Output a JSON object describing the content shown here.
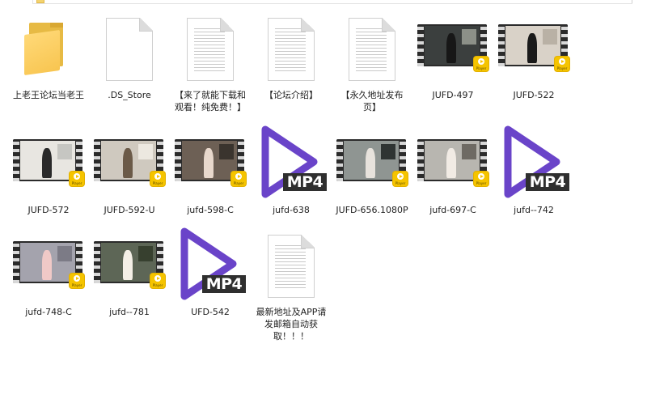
{
  "colors": {
    "folder": "#f8c550",
    "mp4_play": "#6a44c9",
    "player_badge": "#f5c400",
    "mp4_tag": "#2f2f2f"
  },
  "mp4_badge_text": "MP4",
  "player_badge_text": "Player",
  "files": [
    {
      "type": "folder",
      "icon": "folder-icon",
      "name": "上老王论坛当老王"
    },
    {
      "type": "document",
      "icon": "blank-document-icon",
      "name": ".DS_Store"
    },
    {
      "type": "document",
      "icon": "text-document-icon",
      "name": "【来了就能下载和观看！纯免费！】"
    },
    {
      "type": "document",
      "icon": "text-document-icon",
      "name": "【论坛介绍】"
    },
    {
      "type": "document",
      "icon": "text-document-icon",
      "name": "【永久地址发布页】"
    },
    {
      "type": "video",
      "icon": "video-thumbnail-icon",
      "name": "JUFD-497"
    },
    {
      "type": "video",
      "icon": "video-thumbnail-icon",
      "name": "JUFD-522"
    },
    {
      "type": "video",
      "icon": "video-thumbnail-icon",
      "name": "JUFD-572"
    },
    {
      "type": "video",
      "icon": "video-thumbnail-icon",
      "name": "JUFD-592-U"
    },
    {
      "type": "video",
      "icon": "video-thumbnail-icon",
      "name": "jufd-598-C"
    },
    {
      "type": "mp4",
      "icon": "mp4-play-icon",
      "name": "jufd-638"
    },
    {
      "type": "video",
      "icon": "video-thumbnail-icon",
      "name": "JUFD-656.1080P"
    },
    {
      "type": "video",
      "icon": "video-thumbnail-icon",
      "name": "jufd-697-C"
    },
    {
      "type": "mp4",
      "icon": "mp4-play-icon",
      "name": "jufd--742"
    },
    {
      "type": "video",
      "icon": "video-thumbnail-icon",
      "name": "jufd-748-C"
    },
    {
      "type": "video",
      "icon": "video-thumbnail-icon",
      "name": "jufd--781"
    },
    {
      "type": "mp4",
      "icon": "mp4-play-icon",
      "name": "UFD-542"
    },
    {
      "type": "document",
      "icon": "text-document-icon",
      "name": "最新地址及APP请发邮箱自动获取！！！"
    }
  ]
}
